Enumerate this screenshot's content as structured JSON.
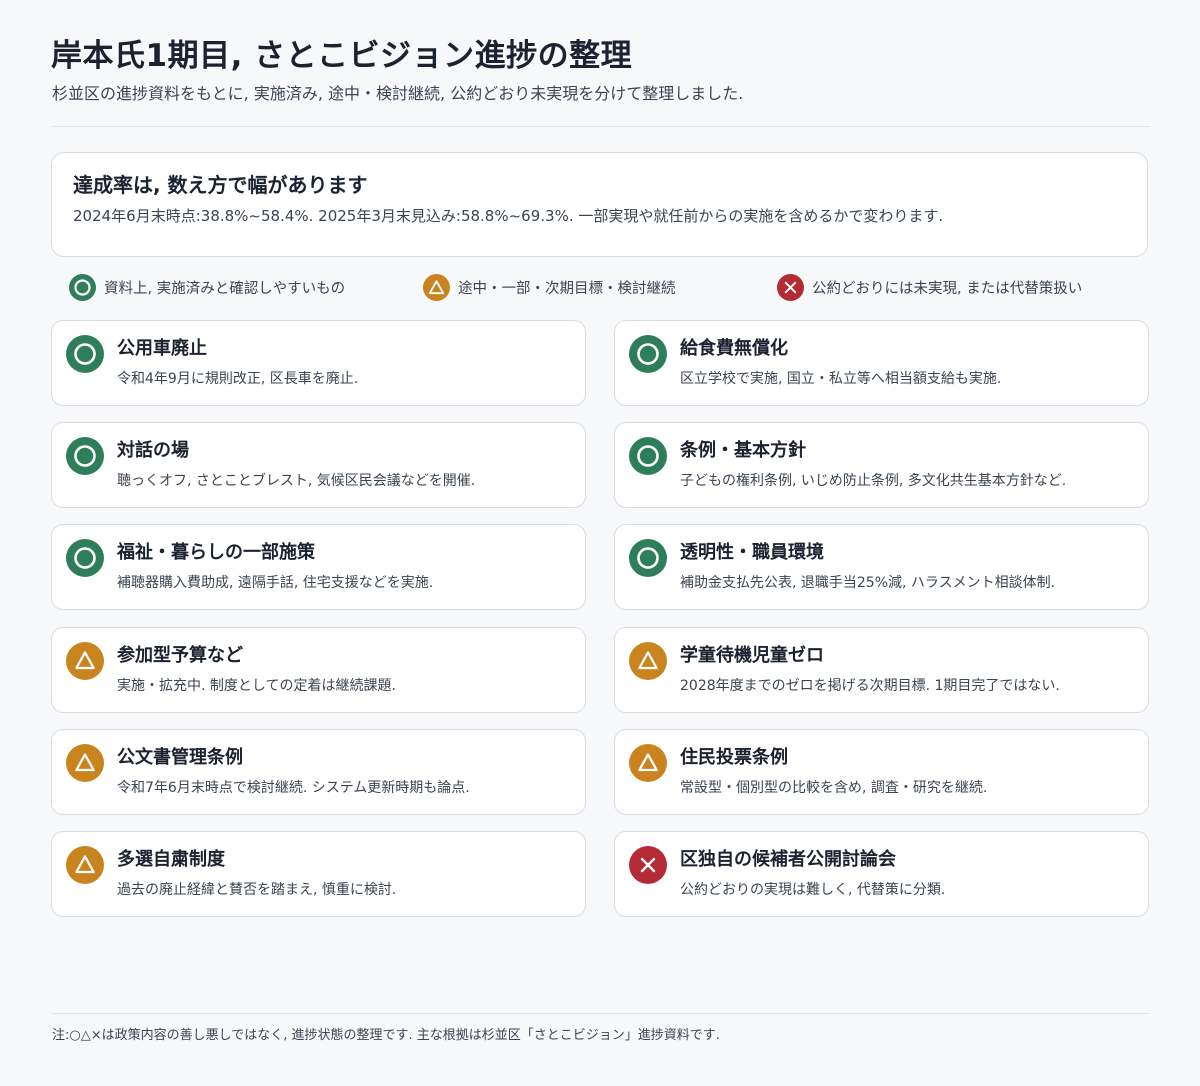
{
  "page": {
    "title": "岸本氏1期目, さとこビジョン進捗の整理",
    "subtitle": "杉並区の進捗資料をもとに, 実施済み, 途中・検討継続, 公約どおり未実現を分けて整理しました."
  },
  "summary": {
    "heading": "達成率は, 数え方で幅があります",
    "body": "2024年6月末時点:38.8%~58.4%. 2025年3月末見込み:58.8%~69.3%. 一部実現や就任前からの実施を含めるかで変わります."
  },
  "legend": [
    {
      "status": "done",
      "icon": "circle-icon",
      "label": "資料上, 実施済みと確認しやすいもの"
    },
    {
      "status": "partial",
      "icon": "triangle-icon",
      "label": "途中・一部・次期目標・検討継続"
    },
    {
      "status": "not",
      "icon": "cross-icon",
      "label": "公約どおりには未実現, または代替策扱い"
    }
  ],
  "colors": {
    "done": "#2e7d5b",
    "partial": "#c9831f",
    "not": "#b42b35"
  },
  "items": [
    {
      "status": "done",
      "icon": "circle-icon",
      "title": "公用車廃止",
      "desc": "令和4年9月に規則改正, 区長車を廃止."
    },
    {
      "status": "done",
      "icon": "circle-icon",
      "title": "給食費無償化",
      "desc": "区立学校で実施, 国立・私立等へ相当額支給も実施."
    },
    {
      "status": "done",
      "icon": "circle-icon",
      "title": "対話の場",
      "desc": "聴っくオフ, さとことブレスト, 気候区民会議などを開催."
    },
    {
      "status": "done",
      "icon": "circle-icon",
      "title": "条例・基本方針",
      "desc": "子どもの権利条例, いじめ防止条例, 多文化共生基本方針など."
    },
    {
      "status": "done",
      "icon": "circle-icon",
      "title": "福祉・暮らしの一部施策",
      "desc": "補聴器購入費助成, 遠隔手話, 住宅支援などを実施."
    },
    {
      "status": "done",
      "icon": "circle-icon",
      "title": "透明性・職員環境",
      "desc": "補助金支払先公表, 退職手当25%減, ハラスメント相談体制."
    },
    {
      "status": "partial",
      "icon": "triangle-icon",
      "title": "参加型予算など",
      "desc": "実施・拡充中. 制度としての定着は継続課題."
    },
    {
      "status": "partial",
      "icon": "triangle-icon",
      "title": "学童待機児童ゼロ",
      "desc": "2028年度までのゼロを掲げる次期目標. 1期目完了ではない."
    },
    {
      "status": "partial",
      "icon": "triangle-icon",
      "title": "公文書管理条例",
      "desc": "令和7年6月末時点で検討継続. システム更新時期も論点."
    },
    {
      "status": "partial",
      "icon": "triangle-icon",
      "title": "住民投票条例",
      "desc": "常設型・個別型の比較を含め, 調査・研究を継続."
    },
    {
      "status": "partial",
      "icon": "triangle-icon",
      "title": "多選自粛制度",
      "desc": "過去の廃止経緯と賛否を踏まえ, 慎重に検討."
    },
    {
      "status": "not",
      "icon": "cross-icon",
      "title": "区独自の候補者公開討論会",
      "desc": "公約どおりの実現は難しく, 代替策に分類."
    }
  ],
  "footer": {
    "note": "注:○△×は政策内容の善し悪しではなく, 進捗状態の整理です. 主な根拠は杉並区「さとこビジョン」進捗資料です."
  }
}
